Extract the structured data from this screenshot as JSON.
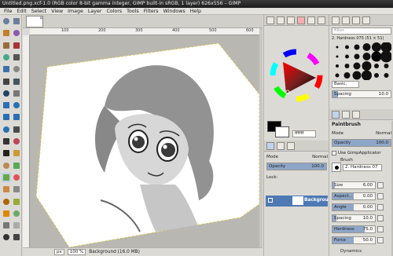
{
  "window": {
    "title": "Untitled.png.xcf-1.0 (RGB color 8-bit gamma integer, GIMP built-in sRGB, 1 layer) 626x556 – GIMP"
  },
  "menu": [
    "File",
    "Edit",
    "Select",
    "View",
    "Image",
    "Layer",
    "Colors",
    "Tools",
    "Filters",
    "Windows",
    "Help"
  ],
  "ruler": {
    "h": [
      "100",
      "200",
      "300",
      "400",
      "500",
      "600"
    ]
  },
  "status": {
    "unit": "px",
    "zoom": "100 %",
    "info": "Background (16.0 MB)"
  },
  "colors": {
    "hex": "ffffff",
    "accent": "#4e79b4"
  },
  "layers": {
    "mode_label": "Mode",
    "mode": "Normal",
    "opacity_label": "Opacity",
    "opacity": "100.0",
    "lock_label": "Lock:",
    "layer_name": "Background"
  },
  "brushes": {
    "filter": "filter",
    "name": "2. Hardness 075 (51 × 51)",
    "preset": "Basic,",
    "spacing_label": "Spacing",
    "spacing": "10.0"
  },
  "tool_options": {
    "title": "Paintbrush",
    "mode_label": "Mode",
    "mode": "Normal",
    "opacity_label": "Opacity",
    "opacity": "100.0",
    "opacity_fraction": 1.0,
    "applicator_label": "Use GimpApplicator",
    "brush_label": "Brush",
    "brush_name": "2. Hardness 07",
    "size_label": "Size",
    "size": "6.00",
    "aspect_label": "Aspect...",
    "aspect": "0.00",
    "angle_label": "Angle",
    "angle": "0.00",
    "spacing_label": "Spacing",
    "spacing": "10.0",
    "hardness_label": "Hardness",
    "hardness": "75.0",
    "hardness_fraction": 0.75,
    "force_label": "Force",
    "force": "50.0",
    "force_fraction": 0.5,
    "dynamics_label": "Dynamics"
  }
}
